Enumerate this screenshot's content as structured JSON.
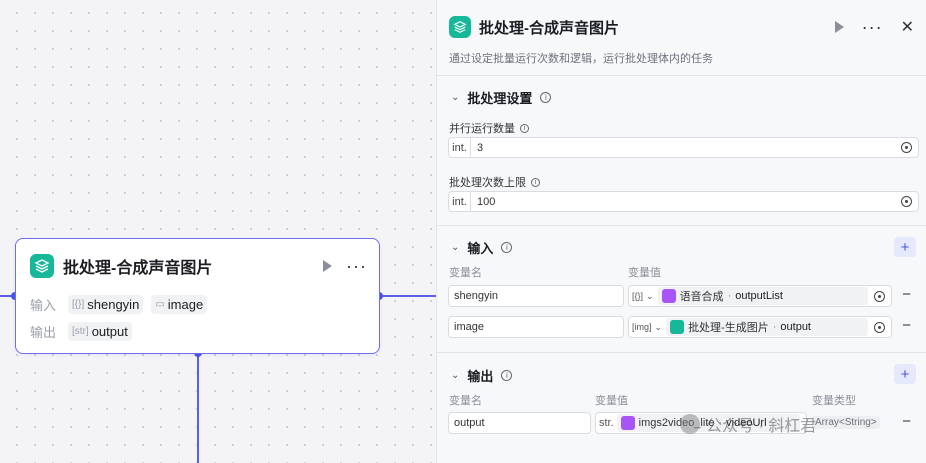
{
  "canvas": {
    "node": {
      "title": "批处理-合成声音图片",
      "input_label": "输入",
      "output_label": "输出",
      "inputs": [
        {
          "icon": "[{}]",
          "name": "shengyin"
        },
        {
          "icon": "image-icon",
          "name": "image"
        }
      ],
      "outputs": [
        {
          "icon": "[str]",
          "name": "output"
        }
      ],
      "more_label": "···"
    }
  },
  "panel": {
    "title": "批处理-合成声音图片",
    "description": "通过设定批量运行次数和逻辑，运行批处理体内的任务",
    "settings": {
      "title": "批处理设置",
      "parallel_label": "并行运行数量",
      "parallel_prefix": "int.",
      "parallel_value": "3",
      "limit_label": "批处理次数上限",
      "limit_prefix": "int.",
      "limit_value": "100"
    },
    "input": {
      "title": "输入",
      "col_name": "变量名",
      "col_value": "变量值",
      "rows": [
        {
          "name": "shengyin",
          "type_icon": "[{}]",
          "node": "语音合成",
          "var": "outputList",
          "icon_color": "#a855f7"
        },
        {
          "name": "image",
          "type_icon": "[img]",
          "node": "批处理-生成图片",
          "var": "output",
          "icon_color": "#17b89a"
        }
      ]
    },
    "output": {
      "title": "输出",
      "col_name": "变量名",
      "col_value": "变量值",
      "col_type": "变量类型",
      "rows": [
        {
          "name": "output",
          "type_prefix": "str.",
          "node": "imgs2video_lite",
          "var": "videoUrl",
          "type": "Array<String>",
          "icon_color": "#a855f7"
        }
      ]
    },
    "watermark": "公众号 · 斜杠君",
    "colors": {
      "accent": "#4d53e8",
      "node_icon": "#17b89a"
    }
  }
}
